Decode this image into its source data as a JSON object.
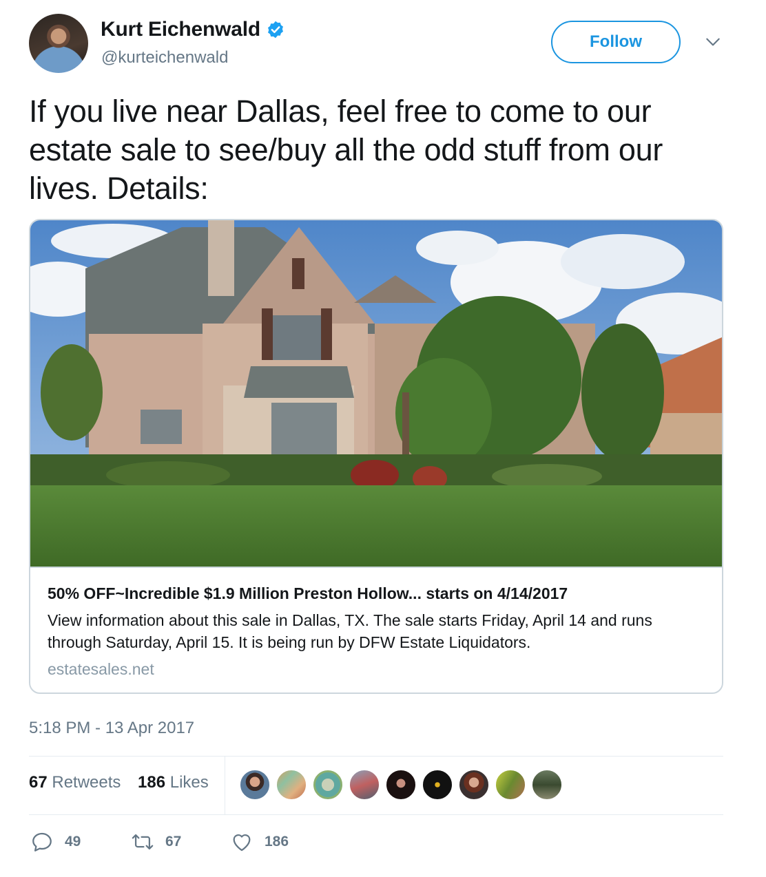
{
  "author": {
    "name": "Kurt Eichenwald",
    "handle": "@kurteichenwald",
    "verified": true
  },
  "follow_label": "Follow",
  "tweet_text": "If you live near Dallas, feel free to come to our estate sale to see/buy all the odd stuff from our lives. Details:",
  "card": {
    "title": "50% OFF~Incredible $1.9 Million Preston Hollow... starts on 4/14/2017",
    "description": "View information about this sale in Dallas, TX. The sale starts Friday, April 14 and runs through Saturday, April 15. It is being run by DFW Estate Liquidators.",
    "domain": "estatesales.net"
  },
  "timestamp": "5:18 PM - 13 Apr 2017",
  "stats": {
    "retweets_count": "67",
    "retweets_label": "Retweets",
    "likes_count": "186",
    "likes_label": "Likes"
  },
  "actions": {
    "replies": "49",
    "retweets": "67",
    "likes": "186"
  },
  "colors": {
    "accent": "#1b95e0",
    "secondary_text": "#657786",
    "border": "#ccd6dd"
  }
}
